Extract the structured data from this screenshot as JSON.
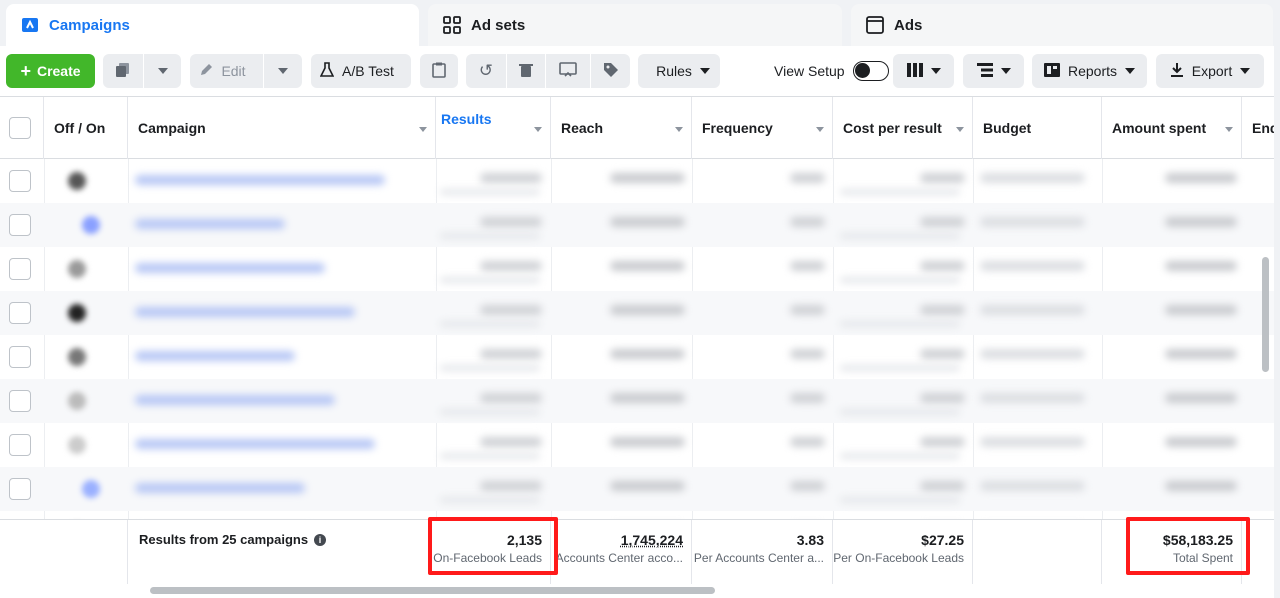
{
  "tabs": [
    {
      "label": "Campaigns",
      "icon": "campaign-flag-icon",
      "active": true
    },
    {
      "label": "Ad sets",
      "icon": "grid-icon",
      "active": false
    },
    {
      "label": "Ads",
      "icon": "ad-window-icon",
      "active": false
    }
  ],
  "toolbar": {
    "create_label": "Create",
    "edit_label": "Edit",
    "ab_test_label": "A/B Test",
    "rules_label": "Rules",
    "view_setup_label": "View Setup",
    "reports_label": "Reports",
    "export_label": "Export"
  },
  "columns": {
    "off_on": "Off / On",
    "campaign": "Campaign",
    "results": "Results",
    "reach": "Reach",
    "frequency": "Frequency",
    "cost_per_result": "Cost per result",
    "budget": "Budget",
    "amount_spent": "Amount spent",
    "ends": "End"
  },
  "summary": {
    "label": "Results from 25 campaigns",
    "results_value": "2,135",
    "results_sub": "On-Facebook Leads",
    "reach_value": "1,745,224",
    "reach_sub": "Accounts Center acco...",
    "frequency_value": "3.83",
    "frequency_sub": "Per Accounts Center a...",
    "cpr_value": "$27.25",
    "cpr_sub": "Per On-Facebook Leads",
    "spent_value": "$58,183.25",
    "spent_sub": "Total Spent"
  },
  "colors": {
    "accent": "#1877f2",
    "create": "#42b72a",
    "highlight": "#ff1a1a"
  }
}
